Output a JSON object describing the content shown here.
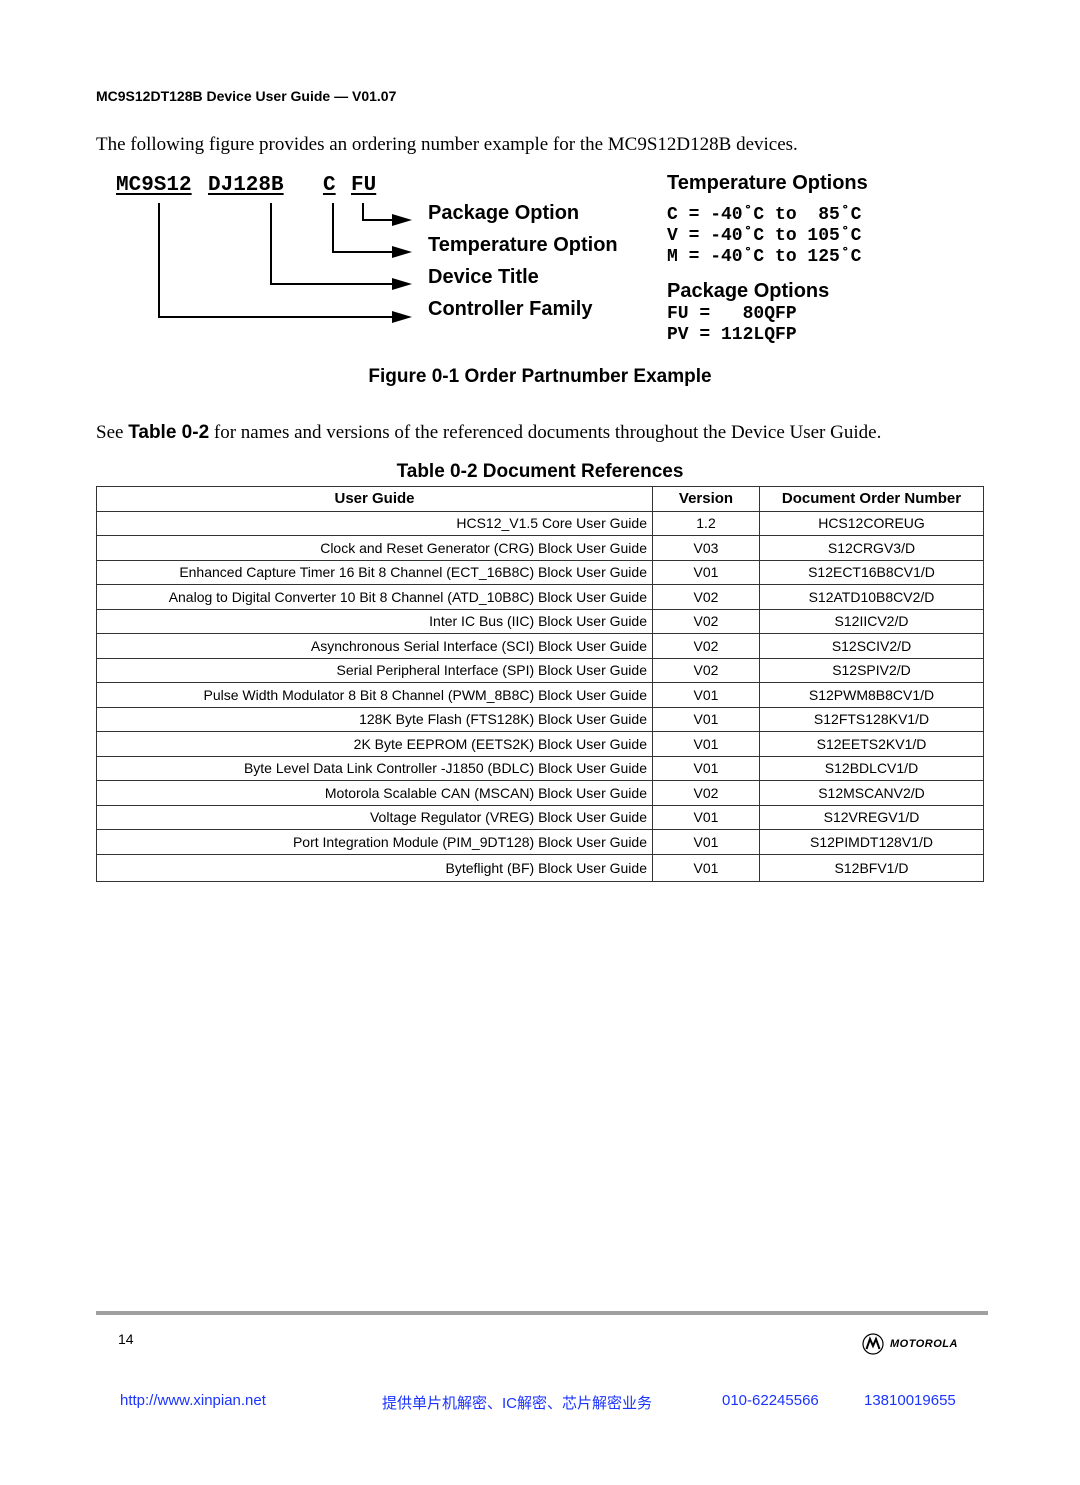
{
  "header": {
    "running_title": "MC9S12DT128B Device User Guide — V01.07"
  },
  "intro_text": "The following figure provides an ordering number example for the MC9S12D128B devices.",
  "figure": {
    "partnumber_segments": [
      "MC9S12",
      "DJ128B",
      "C",
      "FU"
    ],
    "labels": [
      "Package Option",
      "Temperature Option",
      "Device Title",
      "Controller Family"
    ],
    "temperature_options": {
      "title": "Temperature Options",
      "lines": [
        "C = -40˚C to  85˚C",
        "V = -40˚C to 105˚C",
        "M = -40˚C to 125˚C"
      ]
    },
    "package_options": {
      "title": "Package Options",
      "lines": [
        "FU =   80QFP",
        "PV = 112LQFP"
      ]
    },
    "caption": "Figure 0-1  Order Partnumber Example"
  },
  "see_text": {
    "prefix": "See ",
    "ref": "Table 0-2",
    "suffix": " for names and versions of the referenced documents throughout the Device User Guide."
  },
  "table": {
    "caption": "Table 0-2  Document References",
    "headers": [
      "User Guide",
      "Version",
      "Document Order Number"
    ],
    "rows": [
      [
        "HCS12_V1.5 Core User Guide",
        "1.2",
        "HCS12COREUG"
      ],
      [
        "Clock and Reset Generator (CRG) Block User Guide",
        "V03",
        "S12CRGV3/D"
      ],
      [
        "Enhanced Capture Timer 16 Bit 8 Channel (ECT_16B8C) Block User Guide",
        "V01",
        "S12ECT16B8CV1/D"
      ],
      [
        "Analog to Digital Converter 10 Bit 8 Channel (ATD_10B8C) Block User Guide",
        "V02",
        "S12ATD10B8CV2/D"
      ],
      [
        "Inter IC Bus (IIC) Block User Guide",
        "V02",
        "S12IICV2/D"
      ],
      [
        "Asynchronous Serial Interface (SCI) Block User Guide",
        "V02",
        "S12SCIV2/D"
      ],
      [
        "Serial Peripheral Interface (SPI) Block User Guide",
        "V02",
        "S12SPIV2/D"
      ],
      [
        "Pulse Width Modulator 8 Bit 8 Channel (PWM_8B8C) Block User Guide",
        "V01",
        "S12PWM8B8CV1/D"
      ],
      [
        "128K Byte Flash (FTS128K) Block User Guide",
        "V01",
        "S12FTS128KV1/D"
      ],
      [
        "2K Byte EEPROM (EETS2K) Block User Guide",
        "V01",
        "S12EETS2KV1/D"
      ],
      [
        "Byte Level Data Link Controller -J1850 (BDLC) Block User Guide",
        "V01",
        "S12BDLCV1/D"
      ],
      [
        "Motorola Scalable CAN (MSCAN) Block User Guide",
        "V02",
        "S12MSCANV2/D"
      ],
      [
        "Voltage Regulator (VREG) Block User Guide",
        "V01",
        "S12VREGV1/D"
      ],
      [
        "Port Integration Module (PIM_9DT128) Block User Guide",
        "V01",
        "S12PIMDT128V1/D"
      ],
      [
        "Byteflight (BF) Block User Guide",
        "V01",
        "S12BFV1/D"
      ]
    ]
  },
  "footer": {
    "page_number": "14",
    "brand": "MOTOROLA",
    "ad": {
      "url": "http://www.xinpian.net",
      "service": "提供单片机解密、IC解密、芯片解密业务",
      "phone": "010-62245566",
      "mobile": "13810019655",
      "color": "#1a33ff"
    }
  }
}
